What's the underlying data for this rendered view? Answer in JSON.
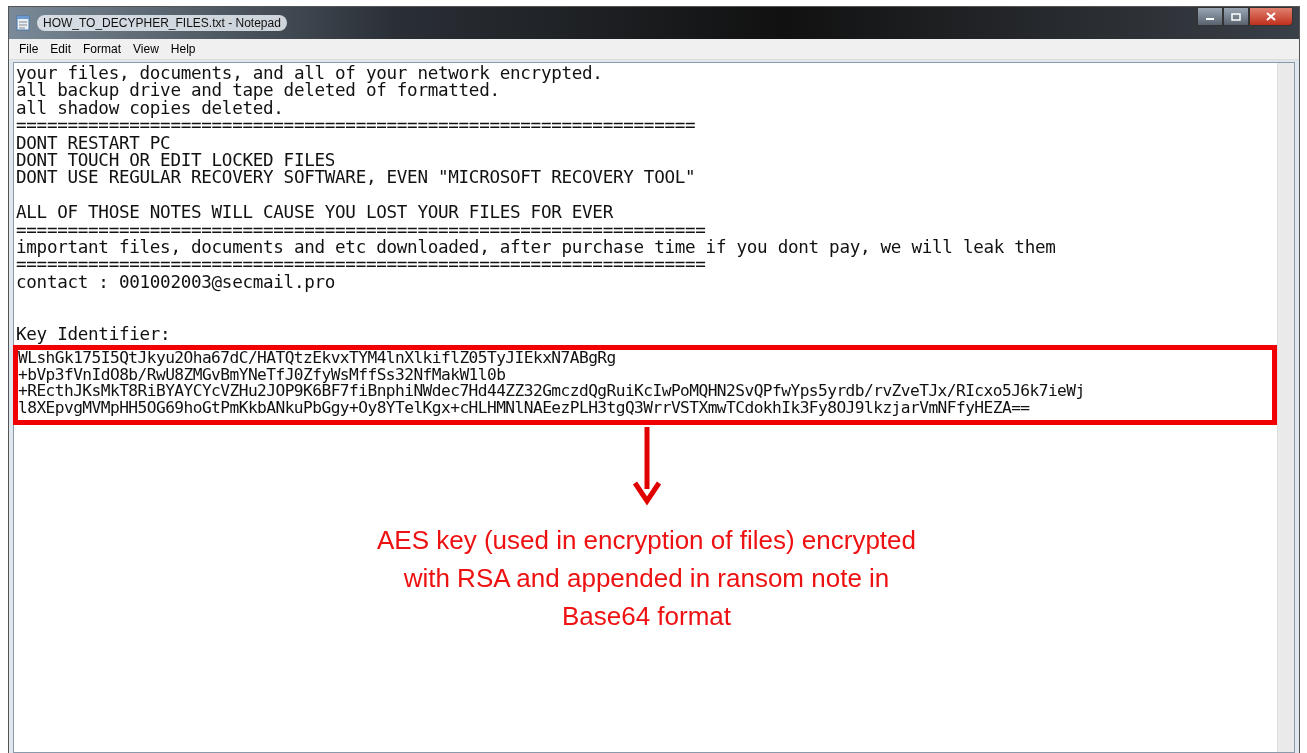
{
  "window": {
    "title": "HOW_TO_DECYPHER_FILES.txt - Notepad"
  },
  "menu": [
    "File",
    "Edit",
    "Format",
    "View",
    "Help"
  ],
  "lines": [
    {
      "kind": "text",
      "text": "your files, documents, and all of your network encrypted."
    },
    {
      "kind": "text",
      "text": "all backup drive and tape deleted of formatted."
    },
    {
      "kind": "text",
      "text": "all shadow copies deleted."
    },
    {
      "kind": "text",
      "text": "=================================================================="
    },
    {
      "kind": "text",
      "text": "DONT RESTART PC"
    },
    {
      "kind": "text",
      "text": "DONT TOUCH OR EDIT LOCKED FILES"
    },
    {
      "kind": "text",
      "text": "DONT USE REGULAR RECOVERY SOFTWARE, EVEN \"MICROSOFT RECOVERY TOOL\""
    },
    {
      "kind": "blank"
    },
    {
      "kind": "text",
      "text": "ALL OF THOSE NOTES WILL CAUSE YOU LOST YOUR FILES FOR EVER"
    },
    {
      "kind": "text",
      "text": "==================================================================="
    },
    {
      "kind": "text",
      "text": "important files, documents and etc downloaded, after purchase time if you dont pay, we will leak them"
    },
    {
      "kind": "text",
      "text": "==================================================================="
    },
    {
      "kind": "text",
      "text": "contact : 001002003@secmail.pro"
    },
    {
      "kind": "blank"
    },
    {
      "kind": "blank"
    },
    {
      "kind": "text",
      "text": "Key Identifier:"
    }
  ],
  "key_lines": [
    "WLshGk175I5QtJkyu2Oha67dC/HATQtzEkvxTYM4lnXlkiflZ05TyJIEkxN7ABgRg",
    "+bVp3fVnIdO8b/RwU8ZMGvBmYNeTfJ0ZfyWsMffSs32NfMakW1l0b",
    "+REcthJKsMkT8RiBYAYCYcVZHu2JOP9K6BF7fiBnphiNWdec7Hd44ZZ32GmczdQgRuiKcIwPoMQHN2SvQPfwYps5yrdb/rvZveTJx/RIcxo5J6k7ieWj",
    "l8XEpvgMVMpHH5OG69hoGtPmKkbANkuPbGgy+Oy8YTelKgx+cHLHMNlNAEezPLH3tgQ3WrrVSTXmwTCdokhIk3Fy8OJ9lkzjarVmNFfyHEZA=="
  ],
  "annotation": [
    "AES key (used in encryption of files) encrypted",
    "with RSA and appended in ransom note in",
    "Base64 format"
  ]
}
